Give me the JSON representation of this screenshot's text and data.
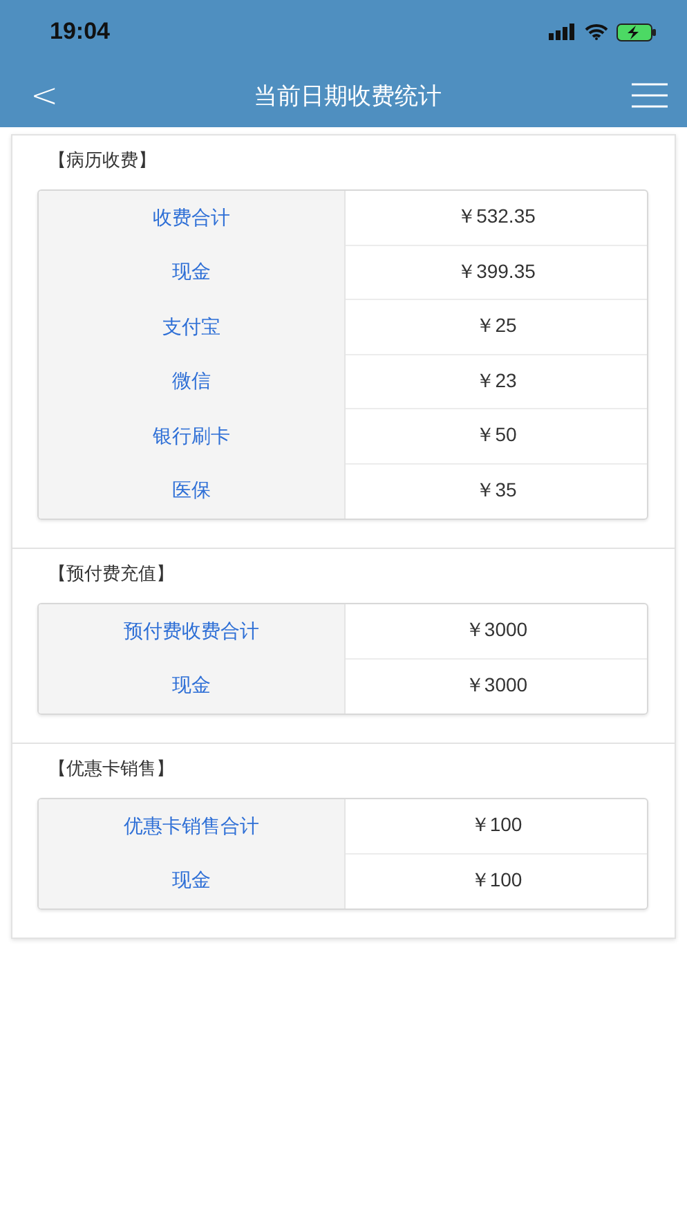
{
  "status_bar": {
    "time": "19:04"
  },
  "header": {
    "back": "<",
    "title": "当前日期收费统计"
  },
  "sections": [
    {
      "title": "【病历收费】",
      "rows": [
        {
          "label": "收费合计",
          "value": "￥532.35"
        },
        {
          "label": "现金",
          "value": "￥399.35"
        },
        {
          "label": "支付宝",
          "value": "￥25"
        },
        {
          "label": "微信",
          "value": "￥23"
        },
        {
          "label": "银行刷卡",
          "value": "￥50"
        },
        {
          "label": "医保",
          "value": "￥35"
        }
      ]
    },
    {
      "title": "【预付费充值】",
      "rows": [
        {
          "label": "预付费收费合计",
          "value": "￥3000"
        },
        {
          "label": "现金",
          "value": "￥3000"
        }
      ]
    },
    {
      "title": "【优惠卡销售】",
      "rows": [
        {
          "label": "优惠卡销售合计",
          "value": "￥100"
        },
        {
          "label": "现金",
          "value": "￥100"
        }
      ]
    }
  ]
}
